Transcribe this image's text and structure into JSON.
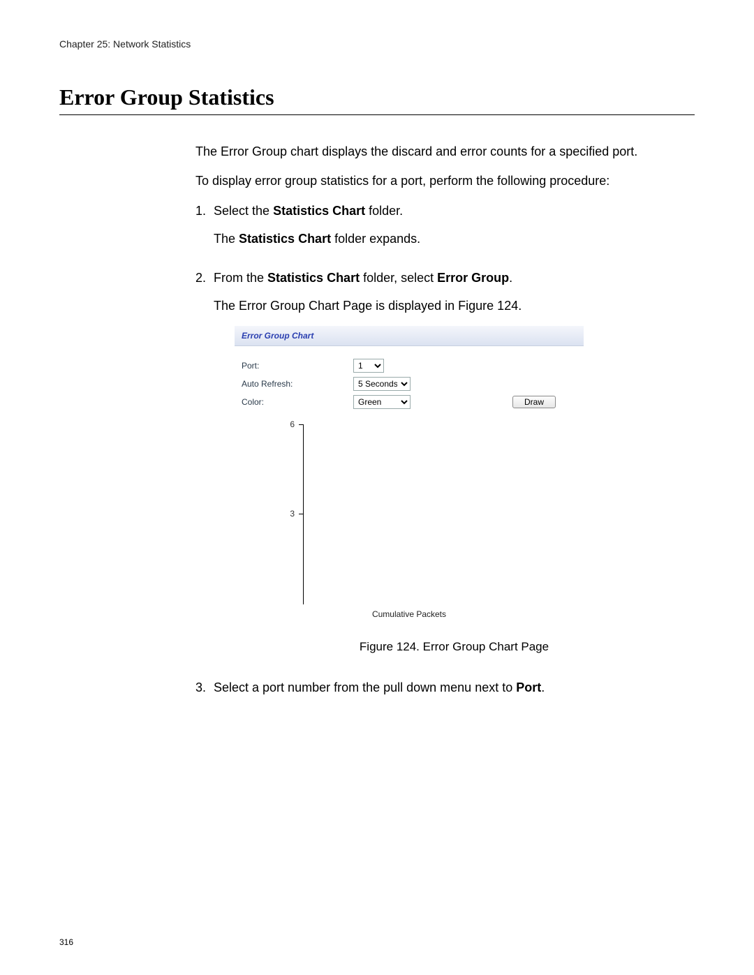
{
  "header": {
    "chapter": "Chapter 25: Network Statistics"
  },
  "title": "Error Group Statistics",
  "intro1": "The Error Group chart displays the discard and error counts for a specified port.",
  "intro2": "To display error group statistics for a port, perform the following procedure:",
  "steps": {
    "s1": {
      "num": "1.",
      "line1_pre": "Select the ",
      "line1_bold": "Statistics Chart",
      "line1_post": " folder.",
      "line2_pre": "The ",
      "line2_bold": "Statistics Chart",
      "line2_post": " folder expands."
    },
    "s2": {
      "num": "2.",
      "line1_pre": "From the ",
      "line1_bold1": "Statistics Chart",
      "line1_mid": " folder, select ",
      "line1_bold2": "Error Group",
      "line1_post": ".",
      "line2": "The Error Group Chart Page is displayed in Figure 124."
    },
    "s3": {
      "num": "3.",
      "line1_pre": "Select a port number from the pull down menu next to ",
      "line1_bold": "Port",
      "line1_post": "."
    }
  },
  "ui": {
    "title": "Error Group Chart",
    "labels": {
      "port": "Port:",
      "refresh": "Auto Refresh:",
      "color": "Color:"
    },
    "values": {
      "port": "1",
      "refresh": "5 Seconds",
      "color": "Green"
    },
    "draw": "Draw",
    "yticks": {
      "top": "6",
      "mid": "3"
    },
    "xlabel": "Cumulative Packets"
  },
  "figure_caption": "Figure 124. Error Group Chart Page",
  "page_number": "316",
  "chart_data": {
    "type": "line",
    "title": "Error Group Chart",
    "xlabel": "Cumulative Packets",
    "ylabel": "",
    "ylim": [
      0,
      6
    ],
    "yticks": [
      3,
      6
    ],
    "series": [],
    "note": "empty chart frame with y-axis only; no plotted data"
  }
}
